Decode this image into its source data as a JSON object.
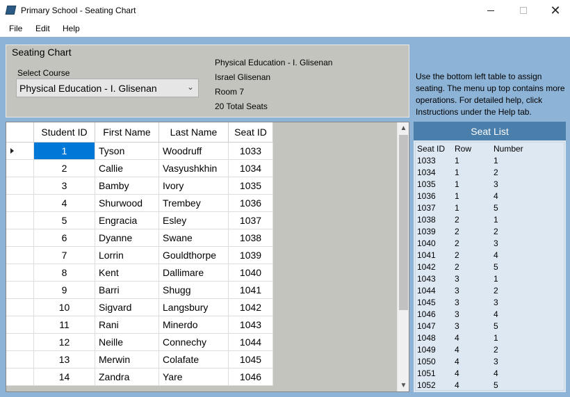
{
  "window": {
    "title": "Primary School - Seating Chart",
    "min_glyph": "",
    "max_glyph": "",
    "close_glyph": "✕"
  },
  "menu": [
    "File",
    "Edit",
    "Help"
  ],
  "seating_group": {
    "title": "Seating Chart",
    "select_label": "Select Course",
    "selected_course": "Physical Education - I. Glisenan",
    "dropdown_glyph": "⌄",
    "info": [
      "Physical Education - I. Glisenan",
      "Israel Glisenan",
      "Room 7",
      "20 Total Seats"
    ]
  },
  "help_text": "Use the bottom left table to assign seating. The menu up top contains more operations. For detailed help, click Instructions under the Help tab.",
  "grid": {
    "columns": [
      "Student ID",
      "First Name",
      "Last Name",
      "Seat ID"
    ],
    "rows": [
      [
        "1",
        "Tyson",
        "Woodruff",
        "1033"
      ],
      [
        "2",
        "Callie",
        "Vasyushkhin",
        "1034"
      ],
      [
        "3",
        "Bamby",
        "Ivory",
        "1035"
      ],
      [
        "4",
        "Shurwood",
        "Trembey",
        "1036"
      ],
      [
        "5",
        "Engracia",
        "Esley",
        "1037"
      ],
      [
        "6",
        "Dyanne",
        "Swane",
        "1038"
      ],
      [
        "7",
        "Lorrin",
        "Gouldthorpe",
        "1039"
      ],
      [
        "8",
        "Kent",
        "Dallimare",
        "1040"
      ],
      [
        "9",
        "Barri",
        "Shugg",
        "1041"
      ],
      [
        "10",
        "Sigvard",
        "Langsbury",
        "1042"
      ],
      [
        "11",
        "Rani",
        "Minerdo",
        "1043"
      ],
      [
        "12",
        "Neille",
        "Connechy",
        "1044"
      ],
      [
        "13",
        "Merwin",
        "Colafate",
        "1045"
      ],
      [
        "14",
        "Zandra",
        "Yare",
        "1046"
      ]
    ],
    "selected_row": 0,
    "scroll_up_glyph": "▲",
    "scroll_down_glyph": "▼"
  },
  "seat_list": {
    "title": "Seat List",
    "columns": [
      "Seat ID",
      "Row",
      "Number"
    ],
    "rows": [
      [
        "1033",
        "1",
        "1"
      ],
      [
        "1034",
        "1",
        "2"
      ],
      [
        "1035",
        "1",
        "3"
      ],
      [
        "1036",
        "1",
        "4"
      ],
      [
        "1037",
        "1",
        "5"
      ],
      [
        "1038",
        "2",
        "1"
      ],
      [
        "1039",
        "2",
        "2"
      ],
      [
        "1040",
        "2",
        "3"
      ],
      [
        "1041",
        "2",
        "4"
      ],
      [
        "1042",
        "2",
        "5"
      ],
      [
        "1043",
        "3",
        "1"
      ],
      [
        "1044",
        "3",
        "2"
      ],
      [
        "1045",
        "3",
        "3"
      ],
      [
        "1046",
        "3",
        "4"
      ],
      [
        "1047",
        "3",
        "5"
      ],
      [
        "1048",
        "4",
        "1"
      ],
      [
        "1049",
        "4",
        "2"
      ],
      [
        "1050",
        "4",
        "3"
      ],
      [
        "1051",
        "4",
        "4"
      ],
      [
        "1052",
        "4",
        "5"
      ]
    ]
  },
  "colors": {
    "accent": "#0078d7",
    "background": "#8db3d6",
    "panel": "#c4c4be",
    "seat_header": "#4a7eab"
  }
}
